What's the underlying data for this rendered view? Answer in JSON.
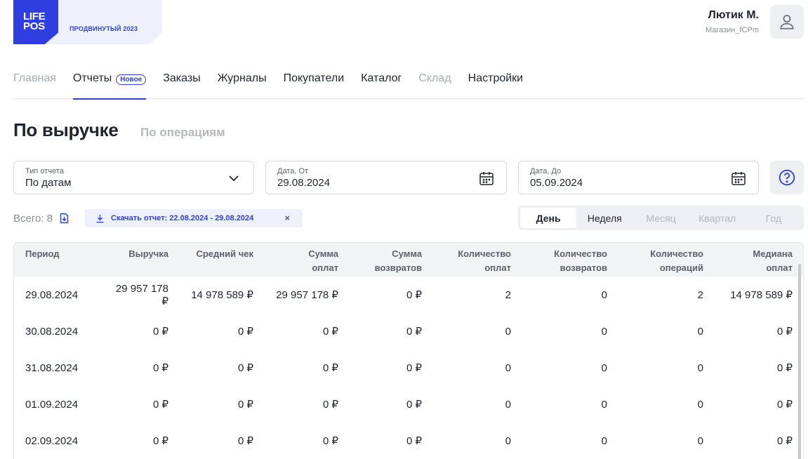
{
  "logo": {
    "line1": "LIFE",
    "line2": "POS",
    "plan": "ПРОДВИНУТЫЙ 2023"
  },
  "user": {
    "name": "Лютик М.",
    "store": "Магазин_fCPm"
  },
  "nav": [
    {
      "label": "Главная",
      "state": "muted"
    },
    {
      "label": "Отчеты",
      "state": "active",
      "badge": "Новое"
    },
    {
      "label": "Заказы",
      "state": "normal"
    },
    {
      "label": "Журналы",
      "state": "normal"
    },
    {
      "label": "Покупатели",
      "state": "normal"
    },
    {
      "label": "Каталог",
      "state": "normal"
    },
    {
      "label": "Склад",
      "state": "muted"
    },
    {
      "label": "Настройки",
      "state": "normal"
    }
  ],
  "page": {
    "title": "По выручке",
    "alt_tab": "По операциям"
  },
  "filters": {
    "type": {
      "label": "Тип отчета",
      "value": "По датам"
    },
    "from": {
      "label": "Дата, От",
      "value": "29.08.2024"
    },
    "to": {
      "label": "Дата, До",
      "value": "05.09.2024"
    }
  },
  "summary": {
    "total": "Всего: 8",
    "download": "Скачать отчет: 22.08.2024 - 29.08.2024",
    "close": "×"
  },
  "periods": [
    {
      "label": "День",
      "state": "active"
    },
    {
      "label": "Неделя",
      "state": "dark"
    },
    {
      "label": "Месяц",
      "state": "muted"
    },
    {
      "label": "Квартал",
      "state": "muted"
    },
    {
      "label": "Год",
      "state": "muted"
    }
  ],
  "table": {
    "headers": [
      [
        "Период",
        ""
      ],
      [
        "Выручка",
        ""
      ],
      [
        "Средний чек",
        ""
      ],
      [
        "Сумма",
        "оплат"
      ],
      [
        "Сумма",
        "возвратов"
      ],
      [
        "Количество",
        "оплат"
      ],
      [
        "Количество",
        "возвратов"
      ],
      [
        "Количество",
        "операций"
      ],
      [
        "Медиана",
        "оплат"
      ]
    ],
    "rows": [
      [
        "29.08.2024",
        "29 957 178 ₽",
        "14 978 589 ₽",
        "29 957 178 ₽",
        "0 ₽",
        "2",
        "0",
        "2",
        "14 978 589 ₽"
      ],
      [
        "30.08.2024",
        "0 ₽",
        "0 ₽",
        "0 ₽",
        "0 ₽",
        "0",
        "0",
        "0",
        "0 ₽"
      ],
      [
        "31.08.2024",
        "0 ₽",
        "0 ₽",
        "0 ₽",
        "0 ₽",
        "0",
        "0",
        "0",
        "0 ₽"
      ],
      [
        "01.09.2024",
        "0 ₽",
        "0 ₽",
        "0 ₽",
        "0 ₽",
        "0",
        "0",
        "0",
        "0 ₽"
      ],
      [
        "02.09.2024",
        "0 ₽",
        "0 ₽",
        "0 ₽",
        "0 ₽",
        "0",
        "0",
        "0",
        "0 ₽"
      ]
    ]
  },
  "colors": {
    "accent": "#2f3ede",
    "muted": "#a6aab3",
    "text": "#1f2430"
  }
}
